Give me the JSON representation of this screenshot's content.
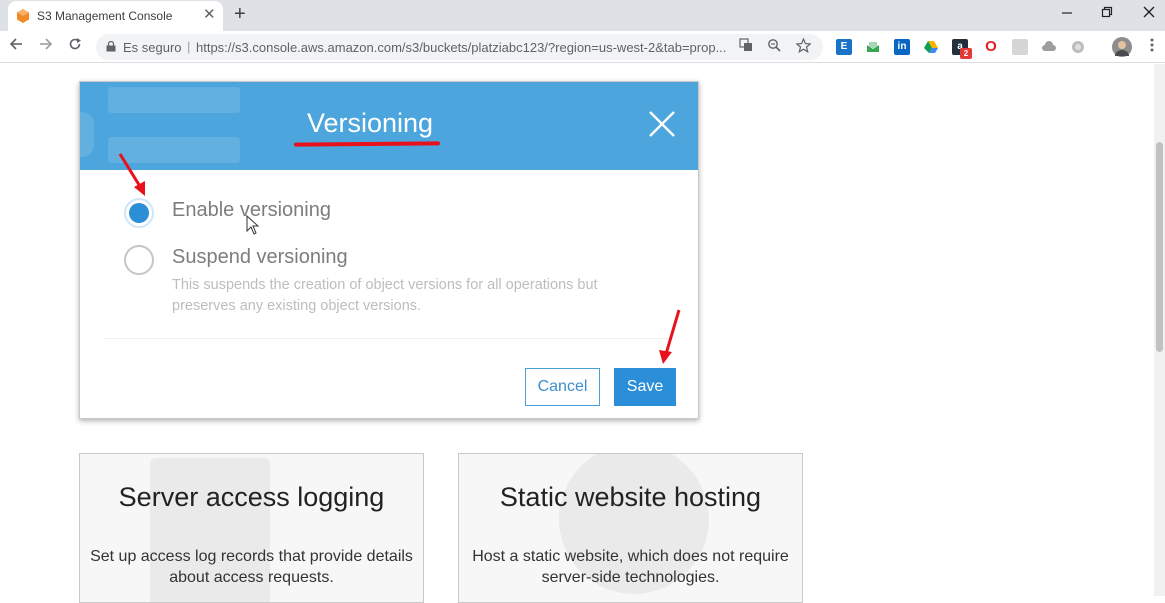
{
  "browser": {
    "tab_title": "S3 Management Console",
    "new_tab_glyph": "+",
    "close_glyph": "✕",
    "security_label": "Es seguro",
    "separator": "|",
    "url": "https://s3.console.aws.amazon.com/s3/buckets/platziabc123/?region=us-west-2&tab=prop...",
    "window_controls": [
      "minimize-icon",
      "restore-icon",
      "close-icon"
    ],
    "extensions": [
      {
        "name": "extension-blue-icon",
        "color": "#1a73c9",
        "glyph": "E"
      },
      {
        "name": "extension-inbox-icon",
        "color": "#34a853",
        "glyph": ""
      },
      {
        "name": "linkedin-icon",
        "color": "#0a66c2",
        "glyph": "in"
      },
      {
        "name": "google-drive-icon",
        "color": "#f4b400",
        "glyph": ""
      },
      {
        "name": "amazon-icon",
        "color": "#232f3e",
        "glyph": "a",
        "badge": "2"
      },
      {
        "name": "opera-icon",
        "color": "#e61e27",
        "glyph": "O"
      },
      {
        "name": "extension-pdf-icon",
        "color": "#cfcfcf",
        "glyph": ""
      },
      {
        "name": "extension-cloud-icon",
        "color": "#9e9e9e",
        "glyph": ""
      },
      {
        "name": "extension-circle-icon",
        "color": "#bdbdbd",
        "glyph": ""
      }
    ]
  },
  "modal": {
    "title": "Versioning",
    "options": [
      {
        "label": "Enable versioning",
        "checked": true
      },
      {
        "label": "Suspend versioning",
        "checked": false,
        "description": "This suspends the creation of object versions for all operations but preserves any existing object versions."
      }
    ],
    "cancel_label": "Cancel",
    "save_label": "Save"
  },
  "cards": [
    {
      "title": "Server access logging",
      "description": "Set up access log records that provide details about access requests."
    },
    {
      "title": "Static website hosting",
      "description": "Host a static website, which does not require server-side technologies."
    }
  ],
  "colors": {
    "header_blue": "#4ca5dc",
    "primary_button": "#2a8fd8",
    "annotation_red": "#e8111b"
  }
}
